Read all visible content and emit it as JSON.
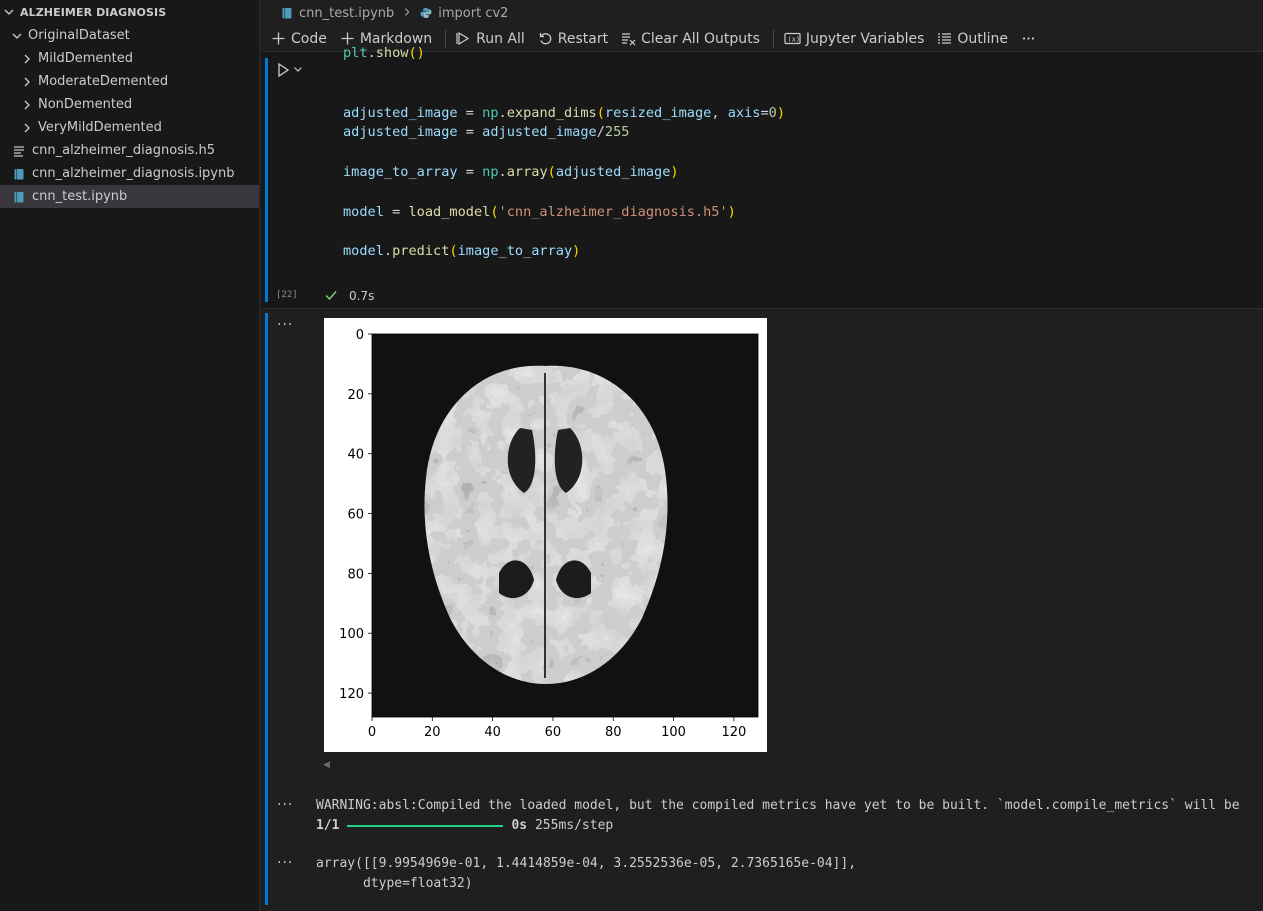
{
  "sidebar": {
    "title": "ALZHEIMER DIAGNOSIS",
    "folder": "OriginalDataset",
    "subfolders": [
      "MildDemented",
      "ModerateDemented",
      "NonDemented",
      "VeryMildDemented"
    ],
    "files": [
      "cnn_alzheimer_diagnosis.h5",
      "cnn_alzheimer_diagnosis.ipynb",
      "cnn_test.ipynb"
    ]
  },
  "breadcrumbs": {
    "file": "cnn_test.ipynb",
    "symbol": "import cv2"
  },
  "toolbar": {
    "code": "Code",
    "markdown": "Markdown",
    "run_all": "Run All",
    "restart": "Restart",
    "clear_outputs": "Clear All Outputs",
    "variables": "Jupyter Variables",
    "outline": "Outline"
  },
  "cell": {
    "line0": {
      "fn": "plt",
      "dot": ".",
      "call": "show",
      "parens": "()"
    },
    "line1": {
      "a": "adjusted_image",
      "eq": " = ",
      "np": "np",
      "dot": ".",
      "fn": "expand_dims",
      "open": "(",
      "arg": "resized_image",
      "comma": ", ",
      "kw": "axis",
      "eqs": "=",
      "num": "0",
      "close": ")"
    },
    "line2": {
      "a": "adjusted_image",
      "eq": " = ",
      "b": "adjusted_image",
      "div": "/",
      "num": "255"
    },
    "line3": {
      "a": "image_to_array",
      "eq": " = ",
      "np": "np",
      "dot": ".",
      "fn": "array",
      "open": "(",
      "arg": "adjusted_image",
      "close": ")"
    },
    "line4": {
      "a": "model",
      "eq": " = ",
      "fn": "load_model",
      "open": "(",
      "str": "'cnn_alzheimer_diagnosis.h5'",
      "close": ")"
    },
    "line5": {
      "a": "model",
      "dot": ".",
      "fn": "predict",
      "open": "(",
      "arg": "image_to_array",
      "close": ")"
    },
    "exec_count": "[22]",
    "exec_time": "0.7s"
  },
  "output": {
    "warning": "WARNING:absl:Compiled the loaded model, but the compiled metrics have yet to be built. `model.compile_metrics` will be",
    "progress_step": "1/1",
    "progress_fraction": 1.0,
    "progress_time": "0s",
    "progress_rate": " 255ms/step",
    "array_line1": "array([[9.9954969e-01, 1.4414859e-04, 3.2552536e-05, 2.7365165e-04]],",
    "array_line2": "      dtype=float32)"
  },
  "chart_data": {
    "type": "image",
    "x_ticks": [
      "0",
      "20",
      "40",
      "60",
      "80",
      "100",
      "120"
    ],
    "y_ticks": [
      "0",
      "20",
      "40",
      "60",
      "80",
      "100",
      "120"
    ],
    "xlim": [
      0,
      128
    ],
    "ylim": [
      128,
      0
    ]
  },
  "colors": {
    "accent": "#0078d4",
    "progress": "#23d18b",
    "check": "#89d185"
  }
}
